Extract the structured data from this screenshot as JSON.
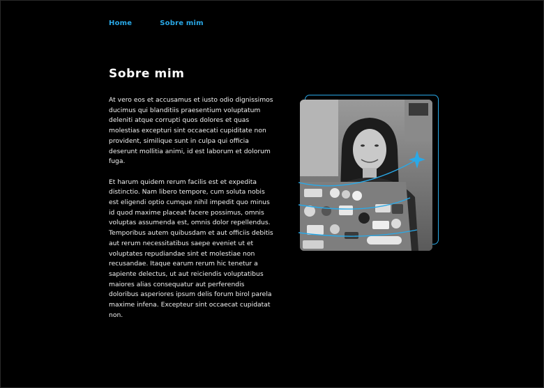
{
  "nav": {
    "items": [
      "Home",
      "Sobre mim"
    ]
  },
  "page": {
    "title": "Sobre mim",
    "paragraphs": [
      "At vero eos et accusamus et iusto odio dignissimos ducimus qui blanditiis praesentium voluptatum deleniti atque corrupti quos dolores et quas molestias excepturi sint occaecati cupiditate non provident, similique sunt in culpa qui officia deserunt mollitia animi, id est laborum et dolorum fuga.",
      "Et harum quidem rerum facilis est et expedita distinctio. Nam libero tempore, cum soluta nobis est eligendi optio cumque nihil impedit quo minus id quod maxime placeat facere possimus, omnis voluptas assumenda est, omnis dolor repellendus. Temporibus autem quibusdam et aut officiis debitis aut rerum necessitatibus saepe eveniet ut et voluptates repudiandae sint et molestiae non recusandae. Itaque earum rerum hic tenetur a sapiente delectus, ut aut reiciendis voluptatibus maiores alias consequatur aut perferendis doloribus asperiores ipsum delis forum birol parela maxime infena. Excepteur sint occaecat cupidatat non."
    ]
  },
  "colors": {
    "background": "#000000",
    "accent": "#29a9e8",
    "text": "#f2f2f2"
  },
  "icons": {
    "photo": "woman-with-laptop-photo",
    "sparkle": "sparkle-icon"
  }
}
